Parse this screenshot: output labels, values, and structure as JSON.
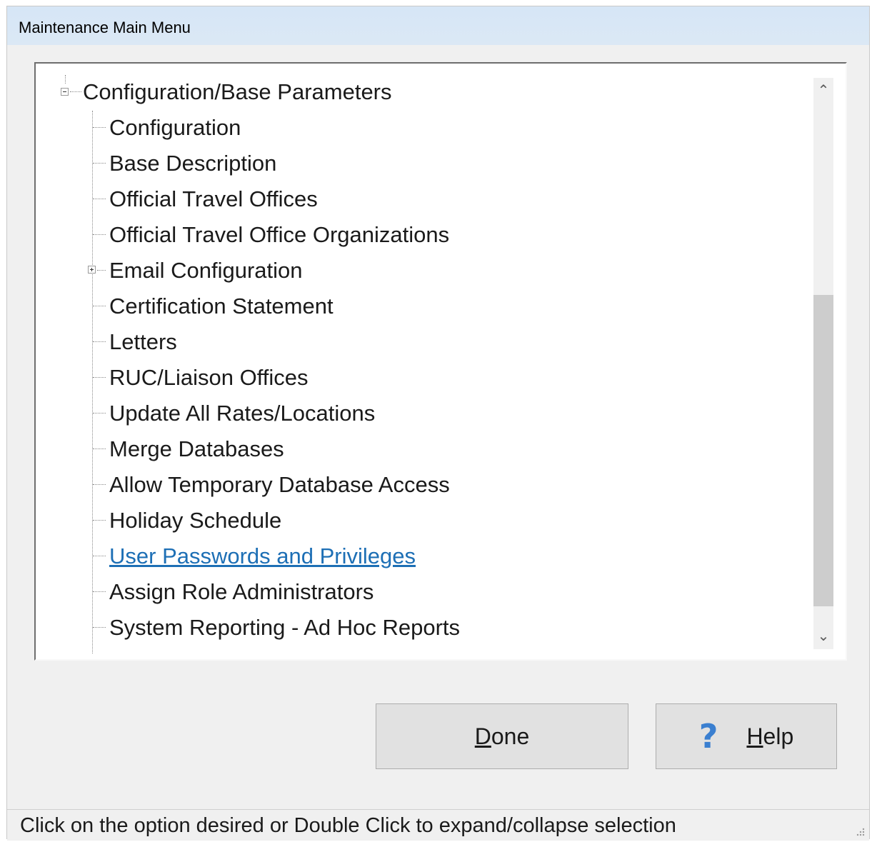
{
  "window": {
    "title": "Maintenance Main Menu"
  },
  "tree": {
    "root": {
      "label": "Configuration/Base Parameters",
      "expanded": true
    },
    "items": [
      {
        "label": "Configuration"
      },
      {
        "label": "Base Description"
      },
      {
        "label": "Official Travel Offices"
      },
      {
        "label": "Official Travel Office Organizations"
      },
      {
        "label": "Email Configuration",
        "expandable": true
      },
      {
        "label": "Certification Statement"
      },
      {
        "label": "Letters"
      },
      {
        "label": "RUC/Liaison Offices"
      },
      {
        "label": "Update All Rates/Locations"
      },
      {
        "label": "Merge Databases"
      },
      {
        "label": "Allow Temporary Database Access"
      },
      {
        "label": "Holiday Schedule"
      },
      {
        "label": "User Passwords and Privileges",
        "hovered": true
      },
      {
        "label": "Assign Role Administrators"
      },
      {
        "label": "System Reporting - Ad Hoc Reports"
      }
    ]
  },
  "buttons": {
    "done": {
      "mnemonic": "D",
      "rest": "one"
    },
    "help": {
      "icon": "question-mark-icon",
      "mnemonic": "H",
      "rest": "elp"
    }
  },
  "status": {
    "text": "Click on the option desired or Double Click to expand/collapse selection"
  },
  "colors": {
    "link": "#1d6fb5",
    "help_icon": "#3a7fd0"
  }
}
